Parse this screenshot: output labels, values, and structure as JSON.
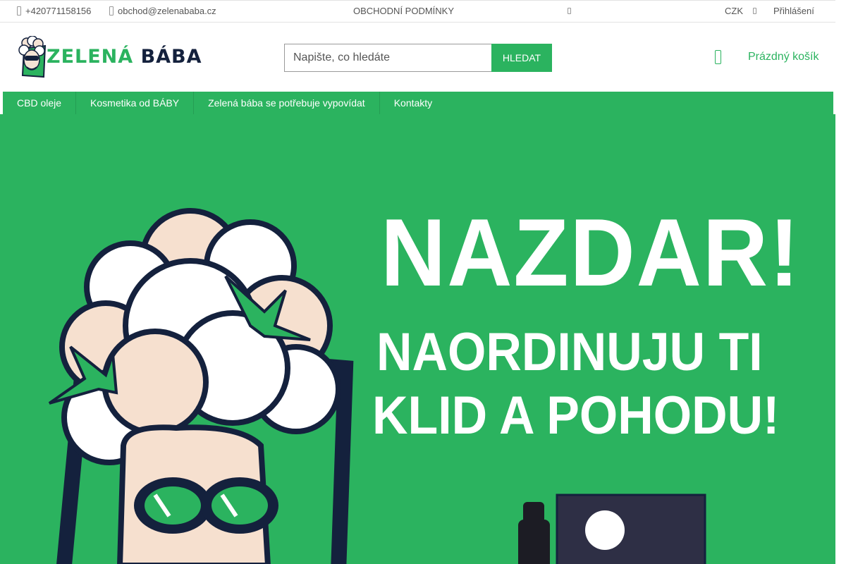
{
  "topbar": {
    "phone": "+420771158156",
    "email": "obchod@zelenababa.cz",
    "terms_link": "OBCHODNÍ PODMÍNKY",
    "currency": "CZK",
    "login": "Přihlášení"
  },
  "header": {
    "logo": {
      "part1": "ZELENÁ",
      "part2": "BÁBA"
    },
    "search": {
      "placeholder": "Napište, co hledáte",
      "value": "",
      "button": "HLEDAT"
    },
    "cart": {
      "label": "Prázdný košík"
    }
  },
  "nav": {
    "items": [
      {
        "label": "CBD oleje"
      },
      {
        "label": "Kosmetika od BÁBY"
      },
      {
        "label": "Zelená bába se potřebuje vypovídat"
      },
      {
        "label": "Kontakty"
      }
    ]
  },
  "hero": {
    "line1": "NAZDAR!",
    "line2": "NAORDINUJU TI",
    "line3": "KLID A POHODU!"
  },
  "colors": {
    "accent": "#2bb35f",
    "navy": "#14213d"
  },
  "icons": [
    "phone-icon",
    "email-icon",
    "menu-icon",
    "currency-chevron-icon",
    "cart-icon"
  ]
}
